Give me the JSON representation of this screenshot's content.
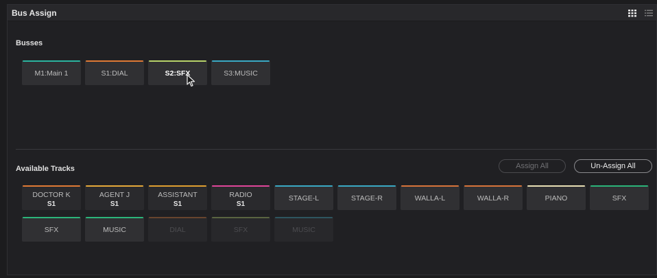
{
  "window": {
    "title": "Bus Assign"
  },
  "busses": {
    "label": "Busses",
    "items": [
      {
        "name": "M1:Main 1",
        "color": "#2bb5a0",
        "state": "normal"
      },
      {
        "name": "S1:DIAL",
        "color": "#e07a35",
        "state": "normal"
      },
      {
        "name": "S2:SFX",
        "color": "#b8d36a",
        "state": "selected"
      },
      {
        "name": "S3:MUSIC",
        "color": "#3aa9c4",
        "state": "normal"
      }
    ]
  },
  "tracks": {
    "label": "Available Tracks",
    "assign_all": "Assign All",
    "unassign_all": "Un-Assign All",
    "items": [
      {
        "name": "DOCTOR K",
        "bus": "S1",
        "color": "#e07a35",
        "state": "assigned"
      },
      {
        "name": "AGENT J",
        "bus": "S1",
        "color": "#e6a93a",
        "state": "assigned"
      },
      {
        "name": "ASSISTANT",
        "bus": "S1",
        "color": "#e0a030",
        "state": "assigned"
      },
      {
        "name": "RADIO",
        "bus": "S1",
        "color": "#e0459a",
        "state": "assigned"
      },
      {
        "name": "STAGE-L",
        "bus": "",
        "color": "#3aa9c4",
        "state": "normal"
      },
      {
        "name": "STAGE-R",
        "bus": "",
        "color": "#3aa9c4",
        "state": "normal"
      },
      {
        "name": "WALLA-L",
        "bus": "",
        "color": "#d8743a",
        "state": "normal"
      },
      {
        "name": "WALLA-R",
        "bus": "",
        "color": "#d8743a",
        "state": "normal"
      },
      {
        "name": "PIANO",
        "bus": "",
        "color": "#e8dfb4",
        "state": "normal"
      },
      {
        "name": "SFX",
        "bus": "",
        "color": "#2bb57a",
        "state": "normal"
      },
      {
        "name": "SFX",
        "bus": "",
        "color": "#2bb57a",
        "state": "normal"
      },
      {
        "name": "MUSIC",
        "bus": "",
        "color": "#2bb57a",
        "state": "normal"
      },
      {
        "name": "DIAL",
        "bus": "",
        "color": "#e07a35",
        "state": "disabled"
      },
      {
        "name": "SFX",
        "bus": "",
        "color": "#b8d36a",
        "state": "disabled"
      },
      {
        "name": "MUSIC",
        "bus": "",
        "color": "#3aa9c4",
        "state": "disabled"
      }
    ]
  },
  "icons": {
    "grid_view": "grid-view-icon",
    "list_view": "list-view-icon",
    "cursor": "mouse-pointer-icon"
  }
}
